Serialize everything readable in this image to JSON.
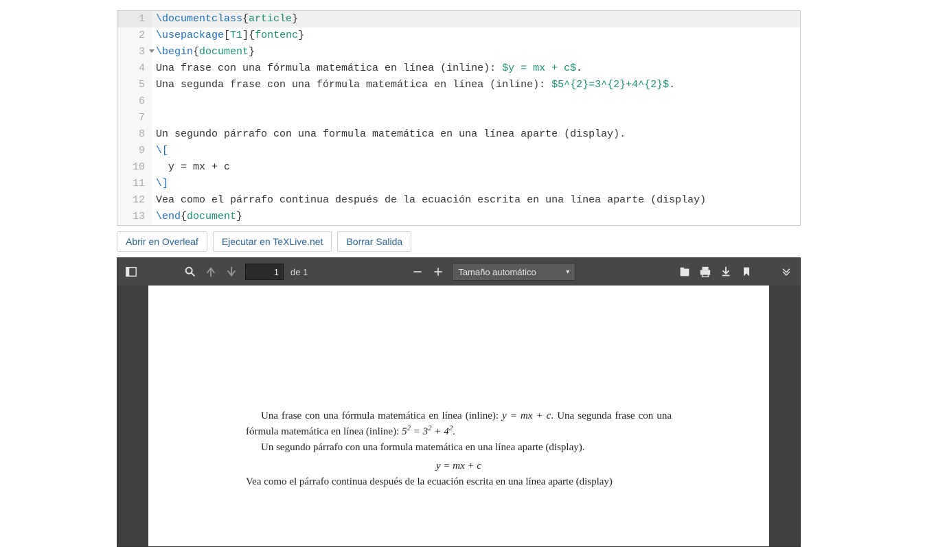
{
  "editor": {
    "lines": [
      {
        "num": "1",
        "active": true,
        "tokens": [
          [
            "cmd",
            "\\documentclass"
          ],
          [
            "brace",
            "{"
          ],
          [
            "arg",
            "article"
          ],
          [
            "brace",
            "}"
          ]
        ]
      },
      {
        "num": "2",
        "tokens": [
          [
            "cmd",
            "\\usepackage"
          ],
          [
            "brace",
            "["
          ],
          [
            "opt",
            "T1"
          ],
          [
            "brace",
            "]{"
          ],
          [
            "arg",
            "fontenc"
          ],
          [
            "brace",
            "}"
          ]
        ]
      },
      {
        "num": "3",
        "fold": true,
        "tokens": [
          [
            "cmd",
            "\\begin"
          ],
          [
            "brace",
            "{"
          ],
          [
            "arg",
            "document"
          ],
          [
            "brace",
            "}"
          ]
        ]
      },
      {
        "num": "4",
        "tokens": [
          [
            "txt",
            "Una frase con una fórmula matemática en línea (inline): "
          ],
          [
            "math",
            "$y = mx + c$"
          ],
          [
            "txt",
            "."
          ]
        ]
      },
      {
        "num": "5",
        "tokens": [
          [
            "txt",
            "Una segunda frase con una fórmula matemática en línea (inline): "
          ],
          [
            "math",
            "$5^{2}=3^{2}+4^{2}$"
          ],
          [
            "txt",
            "."
          ]
        ]
      },
      {
        "num": "6",
        "tokens": []
      },
      {
        "num": "7",
        "tokens": []
      },
      {
        "num": "8",
        "tokens": [
          [
            "txt",
            "Un segundo párrafo con una formula matemática en una línea aparte (display)."
          ]
        ]
      },
      {
        "num": "9",
        "tokens": [
          [
            "cmd",
            "\\["
          ]
        ]
      },
      {
        "num": "10",
        "tokens": [
          [
            "txt",
            "  y = mx + c"
          ]
        ]
      },
      {
        "num": "11",
        "tokens": [
          [
            "cmd",
            "\\]"
          ]
        ]
      },
      {
        "num": "12",
        "tokens": [
          [
            "txt",
            "Vea como el párrafo continua después de la ecuación escrita en una línea aparte (display)"
          ]
        ]
      },
      {
        "num": "13",
        "tokens": [
          [
            "cmd",
            "\\end"
          ],
          [
            "brace",
            "{"
          ],
          [
            "arg",
            "document"
          ],
          [
            "brace",
            "}"
          ]
        ]
      }
    ]
  },
  "buttons": {
    "overleaf": "Abrir en Overleaf",
    "texlive": "Ejecutar en TeXLive.net",
    "clear": "Borrar Salida"
  },
  "pdf_toolbar": {
    "page_value": "1",
    "page_total": "de 1",
    "zoom_label": "Tamaño automático"
  },
  "pdf_document": {
    "p1_a": "Una frase con una fórmula matemática en línea (inline): ",
    "p1_math": "y = mx + c",
    "p1_b": ".  Una segunda frase con una fórmula matemática en línea (inline): ",
    "p1_math2_base1": "5",
    "p1_math2_sup1": "2",
    "p1_math2_eq": " = ",
    "p1_math2_base2": "3",
    "p1_math2_sup2": "2",
    "p1_math2_plus": " + ",
    "p1_math2_base3": "4",
    "p1_math2_sup3": "2",
    "p1_c": ".",
    "p2": "Un segundo párrafo con una formula matemática en una línea aparte (display).",
    "display_math": "y = mx + c",
    "p3": "Vea como el párrafo continua después de la ecuación escrita en una línea aparte (display)"
  }
}
